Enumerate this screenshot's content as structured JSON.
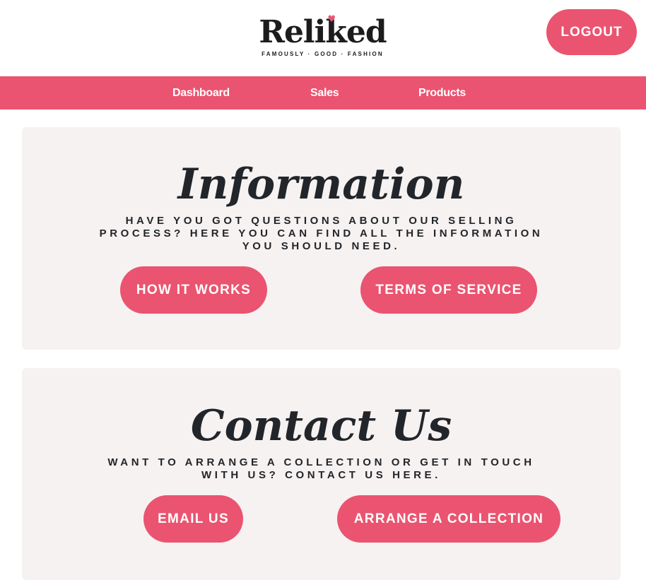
{
  "header": {
    "logo_text": "Reliked",
    "logo_tagline": "FAMOUSLY · GOOD · FASHION",
    "logout_label": "LOGOUT"
  },
  "nav": {
    "items": [
      {
        "label": "Dashboard"
      },
      {
        "label": "Sales"
      },
      {
        "label": "Products"
      }
    ]
  },
  "information": {
    "title": "Information",
    "description_lines": [
      "HAVE YOU GOT QUESTIONS ABOUT OUR SELLING",
      "PROCESS? HERE YOU CAN FIND ALL THE INFORMATION",
      "YOU SHOULD NEED."
    ],
    "how_it_works_label": "HOW IT WORKS",
    "terms_label": "TERMS OF SERVICE"
  },
  "contact": {
    "title": "Contact Us",
    "description_lines": [
      "WANT TO ARRANGE A COLLECTION OR GET IN TOUCH",
      "WITH US? CONTACT US HERE."
    ],
    "email_label": "EMAIL US",
    "collection_label": "ARRANGE A COLLECTION"
  },
  "colors": {
    "accent": "#ea5470",
    "card_background": "#f6f2f1",
    "text": "#22252a"
  },
  "icons": {
    "logo_heart": "heart-icon"
  }
}
